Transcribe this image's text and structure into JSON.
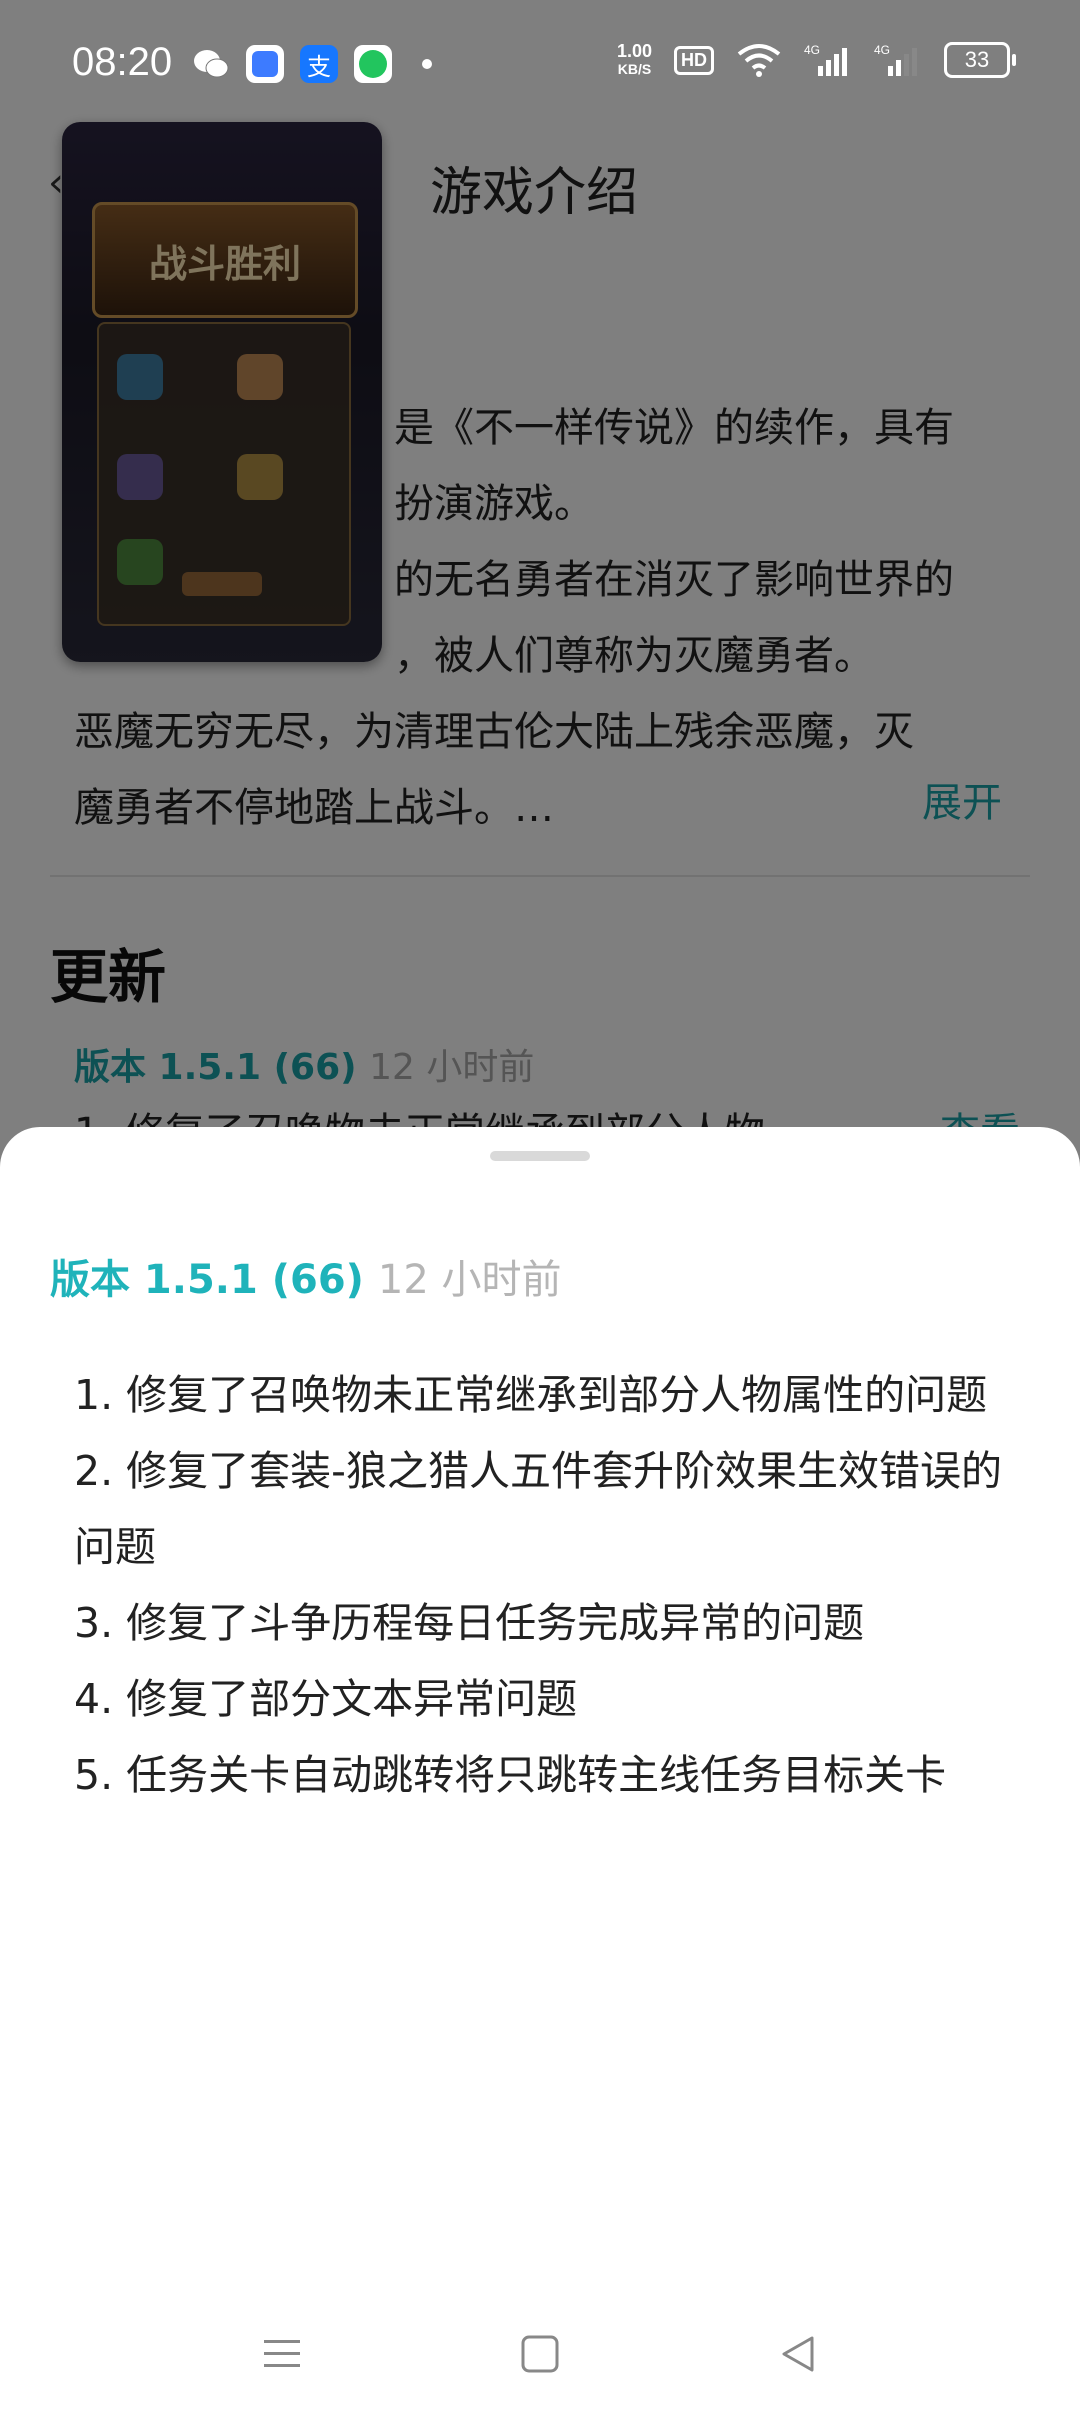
{
  "status_bar": {
    "time": "08:20",
    "speed_value": "1.00",
    "speed_unit": "KB/S",
    "hd_label": "HD",
    "battery": "33",
    "apps": [
      {
        "name": "wechat-icon",
        "color": "#ffffff"
      },
      {
        "name": "app-icon",
        "color": "#3d7bff"
      },
      {
        "name": "alipay-icon",
        "color": "#1677ff"
      },
      {
        "name": "chat-icon",
        "color": "#22c55e"
      }
    ]
  },
  "background": {
    "title": "游戏介绍",
    "thumbnail_banner": "战斗胜利",
    "description_lines": [
      "是《不一样传说》的续作，具有",
      "扮演游戏。",
      "的无名勇者在消灭了影响世界的",
      "，被人们尊称为灭魔勇者。",
      "恶魔无穷无尽，为清理古伦大陆上残余恶魔，灭",
      "魔勇者不停地踏上战斗。…"
    ],
    "expand_label": "展开",
    "update_heading": "更新",
    "version": "版本 1.5.1 (66)",
    "time_ago": "12 小时前",
    "changelog_preview": "1. 修复了召唤物未正常继承到部分人物",
    "view_label": "查看"
  },
  "sheet": {
    "version": "版本 1.5.1 (66)",
    "time_ago": "12 小时前",
    "notes": [
      "1. 修复了召唤物未正常继承到部分人物属性的问题",
      "2. 修复了套装-狼之猎人五件套升阶效果生效错误的问题",
      "3. 修复了斗争历程每日任务完成异常的问题",
      "4. 修复了部分文本异常问题",
      "5. 任务关卡自动跳转将只跳转主线任务目标关卡"
    ]
  },
  "navbar": {
    "icons": [
      "menu-icon",
      "home-icon",
      "back-icon"
    ]
  }
}
